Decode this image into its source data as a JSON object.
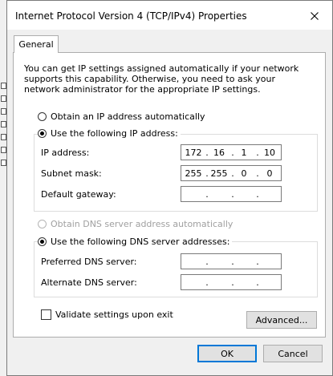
{
  "window": {
    "title": "Internet Protocol Version 4 (TCP/IPv4) Properties"
  },
  "tabs": [
    {
      "label": "General"
    }
  ],
  "description": "You can get IP settings assigned automatically if your network supports this capability. Otherwise, you need to ask your network administrator for the appropriate IP settings.",
  "ip_section": {
    "auto_label": "Obtain an IP address automatically",
    "manual_label": "Use the following IP address:",
    "selected": "manual",
    "fields": [
      {
        "label": "IP address:",
        "octets": [
          "172",
          "16",
          "1",
          "10"
        ]
      },
      {
        "label": "Subnet mask:",
        "octets": [
          "255",
          "255",
          "0",
          "0"
        ]
      },
      {
        "label": "Default gateway:",
        "octets": [
          "",
          "",
          "",
          ""
        ]
      }
    ]
  },
  "dns_section": {
    "auto_label": "Obtain DNS server address automatically",
    "manual_label": "Use the following DNS server addresses:",
    "selected": "manual",
    "fields": [
      {
        "label": "Preferred DNS server:",
        "octets": [
          "",
          "",
          "",
          ""
        ]
      },
      {
        "label": "Alternate DNS server:",
        "octets": [
          "",
          "",
          "",
          ""
        ]
      }
    ]
  },
  "validate": {
    "label": "Validate settings upon exit",
    "checked": false
  },
  "buttons": {
    "advanced": "Advanced...",
    "ok": "OK",
    "cancel": "Cancel"
  },
  "colors": {
    "accent": "#0078d7",
    "dialog_bg": "#f0f0f0",
    "panel_bg": "#ffffff",
    "disabled_text": "#a0a0a0"
  }
}
